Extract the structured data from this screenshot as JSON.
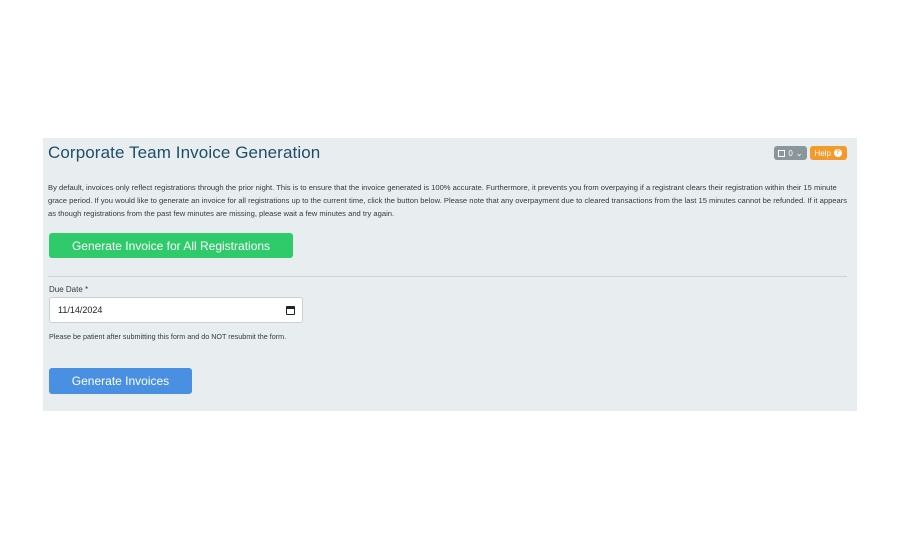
{
  "page": {
    "title": "Corporate Team Invoice Generation",
    "counter_value": "0",
    "help_label": "Help",
    "description": "By default, invoices only reflect registrations through the prior night. This is to ensure that the invoice generated is 100% accurate. Furthermore, it prevents you from overpaying if a registrant clears their registration within their 15 minute grace period. If you would like to generate an invoice for all registrations up to the current time, click the button below. Please note that any overpayment due to cleared transactions from the last 15 minutes cannot be refunded. If it appears as though registrations from the past few minutes are missing, please wait a few minutes and try again.",
    "generate_all_label": "Generate Invoice for All Registrations"
  },
  "form": {
    "due_date_label": "Due Date *",
    "due_date_value": "11/14/2024",
    "note": "Please be patient after submitting this form and do NOT resubmit the form.",
    "submit_label": "Generate Invoices"
  },
  "icons": {
    "counter": "box-icon",
    "counter_dropdown": "chevron-down-icon",
    "help": "question-circle-icon",
    "date": "calendar-icon"
  },
  "colors": {
    "title": "#1f4f68",
    "panel_bg": "#e8edf0",
    "green_button": "#2fca6a",
    "blue_button": "#4a90e2",
    "help_button": "#f39a2b",
    "counter_button": "#8a959c"
  }
}
